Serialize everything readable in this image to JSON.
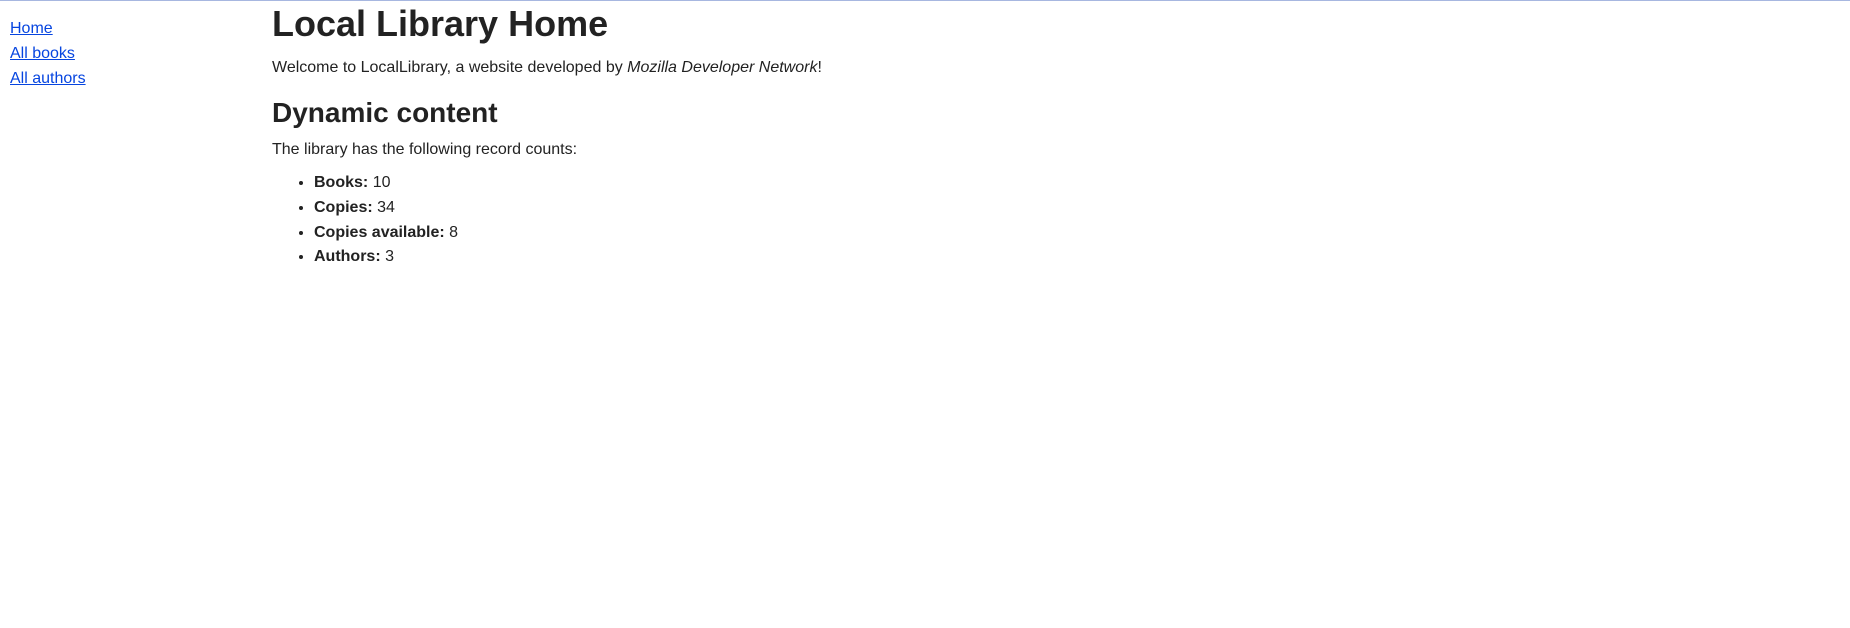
{
  "sidebar": {
    "links": [
      {
        "label": "Home"
      },
      {
        "label": "All books"
      },
      {
        "label": "All authors"
      }
    ]
  },
  "main": {
    "title": "Local Library Home",
    "welcome_prefix": "Welcome to LocalLibrary, a website developed by ",
    "welcome_em": "Mozilla Developer Network",
    "welcome_suffix": "!",
    "section_title": "Dynamic content",
    "intro": "The library has the following record counts:",
    "records": [
      {
        "label": "Books:",
        "value": "10"
      },
      {
        "label": "Copies:",
        "value": "34"
      },
      {
        "label": "Copies available:",
        "value": "8"
      },
      {
        "label": "Authors:",
        "value": "3"
      }
    ]
  }
}
